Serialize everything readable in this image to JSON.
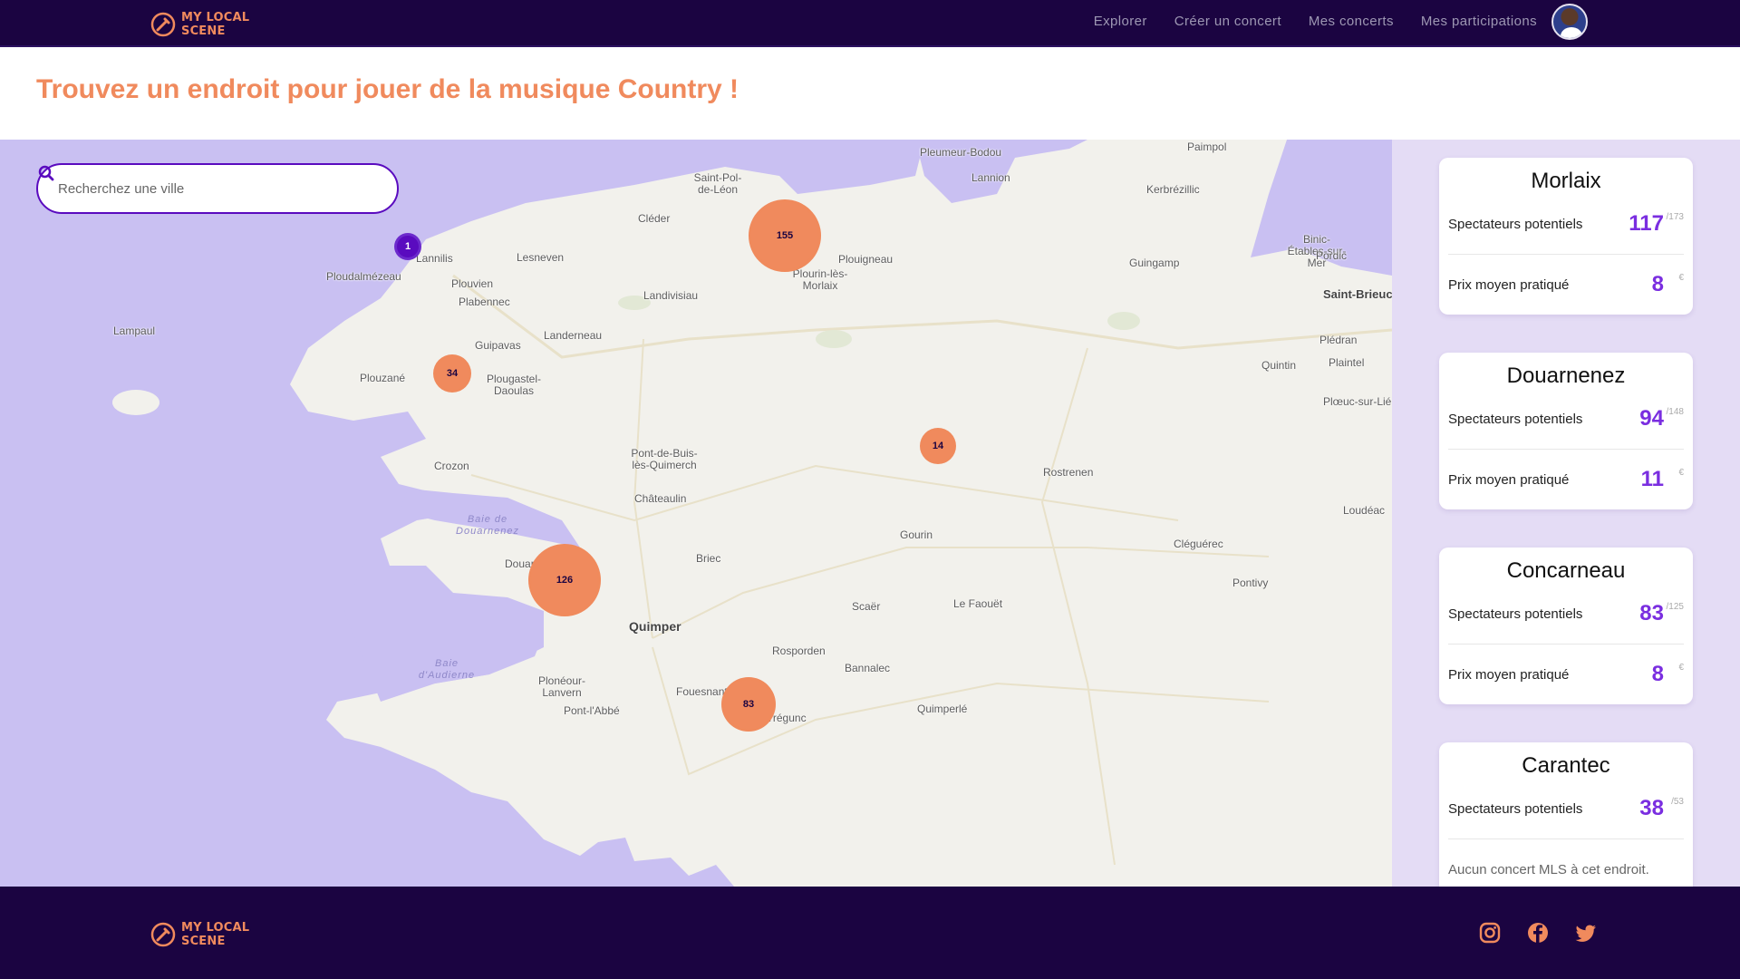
{
  "header": {
    "logo_text_line1": "MY LOCAL",
    "logo_text_line2": "SCENE",
    "nav": [
      "Explorer",
      "Créer un concert",
      "Mes concerts",
      "Mes participations"
    ]
  },
  "page_title": "Trouvez un endroit pour jouer de la musique Country !",
  "search": {
    "placeholder": "Recherchez une ville"
  },
  "map": {
    "places": [
      "Pleumeur-Bodou",
      "Paimpol",
      "Lannion",
      "Kerbrézillic",
      "Saint-Pol-de-Léon",
      "Cléder",
      "Binic-Étables-sur-Mer",
      "Lannilis",
      "Lesneven",
      "Plouigneau",
      "Plourin-lès-Morlaix",
      "Pordic",
      "Guingamp",
      "Ploudalmézeau",
      "Plouvien",
      "Saint-Brieuc",
      "Landivisiau",
      "Plabennec",
      "Lampaul",
      "Landerneau",
      "Plédran",
      "Guipavas",
      "Plouzané",
      "Plougastel-Daoulas",
      "Quintin",
      "Plaintel",
      "Plœuc-sur-Lié",
      "Pont-de-Buis-lès-Quimerch",
      "Crozon",
      "Rostrenen",
      "Châteaulin",
      "Baie de Douarnenez",
      "Loudéac",
      "Gourin",
      "Cléguérec",
      "Briec",
      "Douarnenez",
      "Pontivy",
      "Le Faouët",
      "Scaër",
      "Quimper",
      "Rosporden",
      "Bannalec",
      "Baie d'Audierne",
      "Plonéour-Lanvern",
      "Fouesnant",
      "Quimperlé",
      "Pont-l'Abbé",
      "Trégunc"
    ],
    "clusters": [
      {
        "count": "155",
        "color": "orange"
      },
      {
        "count": "1",
        "color": "purple"
      },
      {
        "count": "34",
        "color": "orange"
      },
      {
        "count": "14",
        "color": "orange"
      },
      {
        "count": "126",
        "color": "orange"
      },
      {
        "count": "83",
        "color": "orange"
      }
    ]
  },
  "cards": [
    {
      "city": "Morlaix",
      "spectators_label": "Spectateurs potentiels",
      "spectators": "117",
      "spectators_total": "/173",
      "price_label": "Prix moyen pratiqué",
      "price": "8",
      "price_unit": "€"
    },
    {
      "city": "Douarnenez",
      "spectators_label": "Spectateurs potentiels",
      "spectators": "94",
      "spectators_total": "/148",
      "price_label": "Prix moyen pratiqué",
      "price": "11",
      "price_unit": "€"
    },
    {
      "city": "Concarneau",
      "spectators_label": "Spectateurs potentiels",
      "spectators": "83",
      "spectators_total": "/125",
      "price_label": "Prix moyen pratiqué",
      "price": "8",
      "price_unit": "€"
    },
    {
      "city": "Carantec",
      "spectators_label": "Spectateurs potentiels",
      "spectators": "38",
      "spectators_total": "/53",
      "note": "Aucun concert MLS à cet endroit."
    }
  ],
  "footer": {
    "logo_text_line1": "MY LOCAL",
    "logo_text_line2": "SCENE",
    "social": [
      "instagram-icon",
      "facebook-icon",
      "twitter-icon"
    ]
  },
  "colors": {
    "brand_dark": "#1b0441",
    "accent_orange": "#f08a5d",
    "accent_purple": "#5a0bbf",
    "sea": "#c9c0f2"
  }
}
